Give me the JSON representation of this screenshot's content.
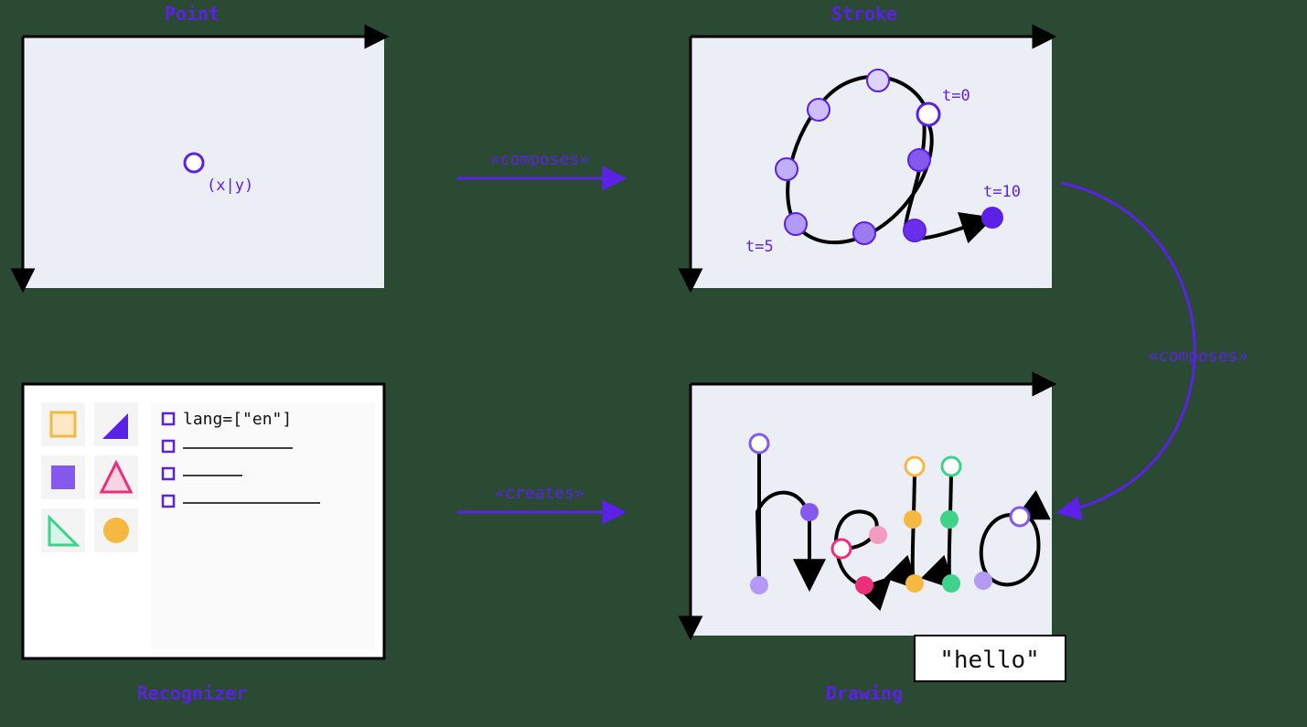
{
  "titles": {
    "point": "Point",
    "stroke": "Stroke",
    "recognizer": "Recognizer",
    "drawing": "Drawing"
  },
  "relations": {
    "composes1": "«composes»",
    "composes2": "«composes»",
    "creates": "«creates»"
  },
  "point_panel": {
    "coord_label": "(x|y)"
  },
  "stroke_panel": {
    "t0": "t=0",
    "t5": "t=5",
    "t10": "t=10"
  },
  "recognizer_panel": {
    "option1": "lang=[\"en\"]"
  },
  "drawing_panel": {
    "output": "\"hello\""
  },
  "colors": {
    "purple": "#5b21e6",
    "purple_light": "#9b7bf0",
    "purple_mid": "#8559ed",
    "purple_dark": "#6a2fe8",
    "orange": "#f5b942",
    "pink": "#ec2f7b",
    "green": "#3fd28b",
    "panel_bg": "#eceef5",
    "white": "#ffffff",
    "black": "#000000",
    "bg": "#2b4a34"
  }
}
